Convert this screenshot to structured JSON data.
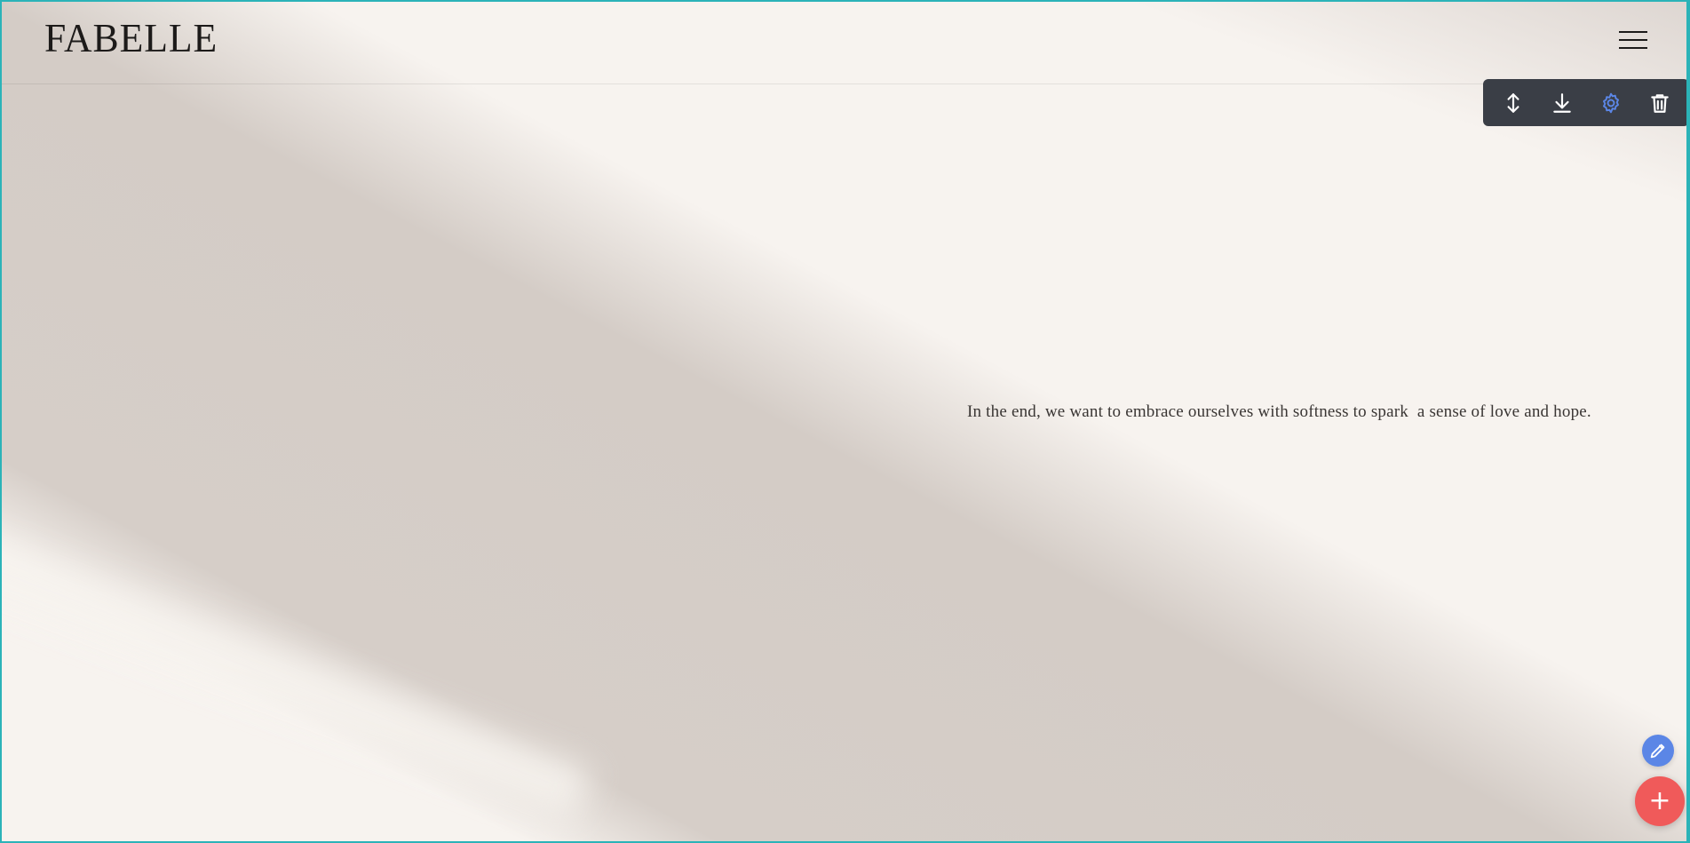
{
  "header": {
    "logo_text": "FABELLE"
  },
  "toolbar": {
    "items": [
      {
        "icon": "resize-vertical-icon",
        "label": "Resize"
      },
      {
        "icon": "download-icon",
        "label": "Download"
      },
      {
        "icon": "gear-icon",
        "label": "Settings",
        "active_color": "#5b86e6"
      },
      {
        "icon": "trash-icon",
        "label": "Delete"
      }
    ]
  },
  "main": {
    "quote": "In the end, we want to embrace ourselves with softness to spark  a sense of love and hope."
  },
  "fab": {
    "edit_icon": "pencil-icon",
    "add_icon": "plus-icon",
    "add_label": "+"
  },
  "colors": {
    "frame_border": "#2bb3b8",
    "toolbar_bg": "#3a3e46",
    "edit_fab": "#5b86e6",
    "add_fab": "#f05a5a"
  }
}
